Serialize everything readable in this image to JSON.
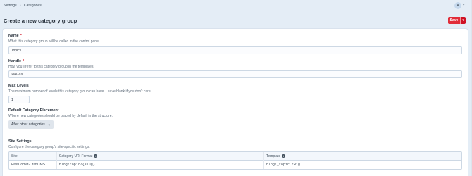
{
  "breadcrumbs": [
    "Settings",
    "Categories"
  ],
  "user": {
    "avatar_letter": "A"
  },
  "header": {
    "title": "Create a new category group",
    "save_label": "Save"
  },
  "fields": {
    "name": {
      "label": "Name",
      "instructions": "What this category group will be called in the control panel.",
      "value": "Topics"
    },
    "handle": {
      "label": "Handle",
      "instructions": "How you'll refer to this category group in the templates.",
      "value": "topics"
    },
    "max_levels": {
      "label": "Max Levels",
      "instructions": "The maximum number of levels this category group can have. Leave blank if you don't care.",
      "value": "1"
    },
    "placement": {
      "label": "Default Category Placement",
      "instructions": "Where new categories should be placed by default in the structure.",
      "selected": "After other categories"
    }
  },
  "site_settings": {
    "label": "Site Settings",
    "instructions": "Configure the category group's site-specific settings.",
    "columns": [
      "Site",
      "Category URI Format",
      "Template"
    ],
    "rows": [
      {
        "site": "FastComet-CraftCMS",
        "uri_format": "blog/topic/{slug}",
        "template": "blog/_topic.twig"
      }
    ]
  }
}
